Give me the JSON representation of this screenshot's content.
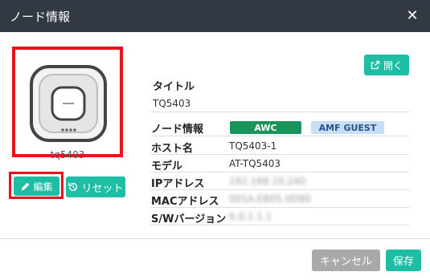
{
  "dialog": {
    "title": "ノード情報",
    "close_glyph": "✕"
  },
  "device": {
    "name": "tq5403"
  },
  "buttons": {
    "edit": "編集",
    "reset": "リセット",
    "open": "開く",
    "cancel": "キャンセル",
    "save": "保存"
  },
  "info": {
    "title_heading": "タイトル",
    "title_value": "TQ5403",
    "node_info_heading": "ノード情報",
    "badges": [
      "AWC",
      "AMF GUEST"
    ],
    "rows": [
      {
        "label": "ホスト名",
        "value": "TQ5403-1"
      },
      {
        "label": "モデル",
        "value": "AT-TQ5403"
      },
      {
        "label": "IPアドレス",
        "value": "192.168.10.240"
      },
      {
        "label": "MACアドレス",
        "value": "001A.EB05.0D80"
      },
      {
        "label": "S/Wバージョン",
        "value": "6.0.1.1.1"
      }
    ]
  },
  "colors": {
    "accent": "#1ebea5",
    "header": "#323942",
    "highlight": "#e8141a",
    "awc": "#19945b",
    "amf": "#c7def7"
  }
}
